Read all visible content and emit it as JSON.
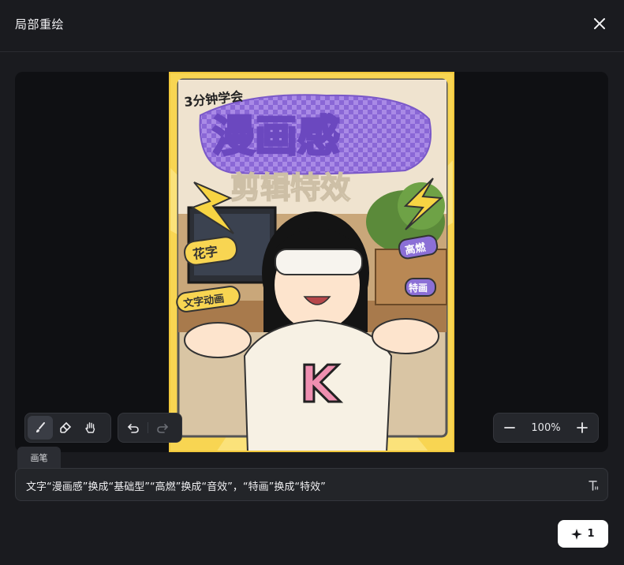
{
  "header": {
    "title": "局部重绘"
  },
  "image": {
    "poster_texts": {
      "kicker": "3分钟学会",
      "headline": "漫画感",
      "subline": "剪辑特效",
      "tag_left_1": "花字",
      "tag_left_2": "文字动画",
      "tag_right_1": "高燃",
      "tag_right_2": "特画",
      "shirt_letter": "K"
    }
  },
  "toolbar": {
    "tools": [
      "brush-icon",
      "eraser-icon",
      "hand-icon"
    ],
    "history": [
      "undo-icon",
      "redo-icon"
    ],
    "tooltip": "画笔"
  },
  "zoom": {
    "value": "100%",
    "minus_icon": "minus-icon",
    "plus_icon": "plus-icon"
  },
  "prompt": {
    "text": "文字“漫画感”换成“基础型”“高燃”换成“音效”，“特画”换成“特效”",
    "icon": "text-style-icon"
  },
  "generate": {
    "icon": "sparkle-icon",
    "label": "1"
  },
  "colors": {
    "bg": "#1a1b1f",
    "canvas": "#0f1013",
    "poster_yellow": "#f6cf4e",
    "purple": "#8b6fd6"
  }
}
